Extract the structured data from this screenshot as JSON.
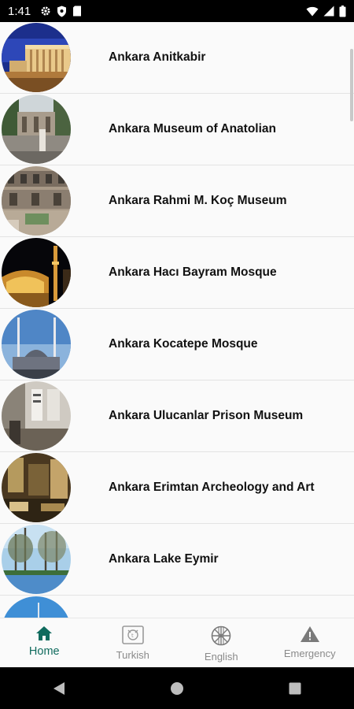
{
  "status_bar": {
    "time": "1:41",
    "icons": [
      "gear-icon",
      "shield-icon",
      "sd-card-icon",
      "wifi-icon",
      "signal-icon",
      "battery-icon"
    ]
  },
  "places": [
    {
      "title": "Ankara Anitkabir",
      "image": "anitkabir-photo"
    },
    {
      "title": "Ankara Museum of Anatolian",
      "image": "museum-anatolian-photo"
    },
    {
      "title": "Ankara Rahmi M. Koç Museum",
      "image": "rahmi-koc-museum-photo"
    },
    {
      "title": "Ankara Hacı Bayram Mosque",
      "image": "haci-bayram-mosque-photo"
    },
    {
      "title": "Ankara Kocatepe Mosque",
      "image": "kocatepe-mosque-photo"
    },
    {
      "title": "Ankara Ulucanlar Prison Museum",
      "image": "ulucanlar-prison-photo"
    },
    {
      "title": "Ankara Erimtan Archeology and Art",
      "image": "erimtan-museum-photo"
    },
    {
      "title": "Ankara Lake Eymir",
      "image": "lake-eymir-photo"
    },
    {
      "title": "",
      "image": "partial-next-photo"
    }
  ],
  "bottom_nav": {
    "items": [
      {
        "label": "Home",
        "icon": "home-icon",
        "active": true
      },
      {
        "label": "Turkish",
        "icon": "turkish-translate-icon",
        "active": false
      },
      {
        "label": "English",
        "icon": "uk-flag-icon",
        "active": false
      },
      {
        "label": "Emergency",
        "icon": "warning-icon",
        "active": false
      }
    ],
    "active_color": "#106b5e",
    "inactive_color": "#8a8a8a"
  },
  "system_nav": [
    "back-button",
    "home-button",
    "recents-button"
  ]
}
